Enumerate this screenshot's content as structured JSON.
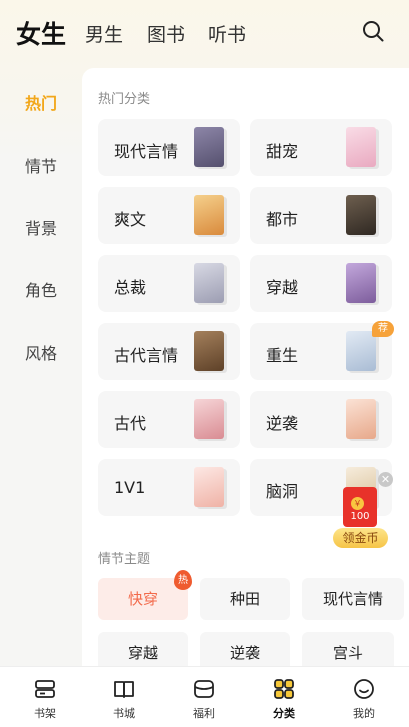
{
  "top_tabs": [
    {
      "label": "女生",
      "active": true
    },
    {
      "label": "男生",
      "active": false
    },
    {
      "label": "图书",
      "active": false
    },
    {
      "label": "听书",
      "active": false
    }
  ],
  "left_nav": [
    {
      "label": "热门",
      "active": true
    },
    {
      "label": "情节",
      "active": false
    },
    {
      "label": "背景",
      "active": false
    },
    {
      "label": "角色",
      "active": false
    },
    {
      "label": "风格",
      "active": false
    }
  ],
  "hot_section": {
    "title": "热门分类",
    "categories": [
      {
        "label": "现代言情",
        "cover_color": "#6f6a8f"
      },
      {
        "label": "甜宠",
        "cover_color": "#f3c6d6"
      },
      {
        "label": "爽文",
        "cover_color": "#e8b05a"
      },
      {
        "label": "都市",
        "cover_color": "#4a3f35"
      },
      {
        "label": "总裁",
        "cover_color": "#b8b9c9"
      },
      {
        "label": "穿越",
        "cover_color": "#9b7db5"
      },
      {
        "label": "古代言情",
        "cover_color": "#7d5a3c"
      },
      {
        "label": "重生",
        "cover_color": "#c9d6e6",
        "badge": "荐"
      },
      {
        "label": "古代",
        "cover_color": "#e7b3b8"
      },
      {
        "label": "逆袭",
        "cover_color": "#f0c3ad"
      },
      {
        "label": "1V1",
        "cover_color": "#f5cfc8"
      },
      {
        "label": "脑洞",
        "cover_color": "#ead9bd"
      }
    ]
  },
  "plot_section": {
    "title": "情节主题",
    "chips": [
      {
        "label": "快穿",
        "hot": true,
        "badge": "热"
      },
      {
        "label": "种田",
        "hot": false
      },
      {
        "label": "现代言情",
        "hot": false
      },
      {
        "label": "穿越",
        "hot": false
      },
      {
        "label": "逆袭",
        "hot": false
      },
      {
        "label": "宫斗",
        "hot": false
      }
    ]
  },
  "coin_widget": {
    "amount": "100",
    "button_label": "领金币",
    "coin_symbol": "￥"
  },
  "bottom_nav": [
    {
      "label": "书架",
      "icon": "bookshelf-icon",
      "active": false
    },
    {
      "label": "书城",
      "icon": "open-book-icon",
      "active": false
    },
    {
      "label": "福利",
      "icon": "gift-box-icon",
      "active": false
    },
    {
      "label": "分类",
      "icon": "category-grid-icon",
      "active": true
    },
    {
      "label": "我的",
      "icon": "smile-face-icon",
      "active": false
    }
  ],
  "colors": {
    "accent": "#f2a71a",
    "hot": "#f26a4b",
    "packet": "#e8322a"
  }
}
